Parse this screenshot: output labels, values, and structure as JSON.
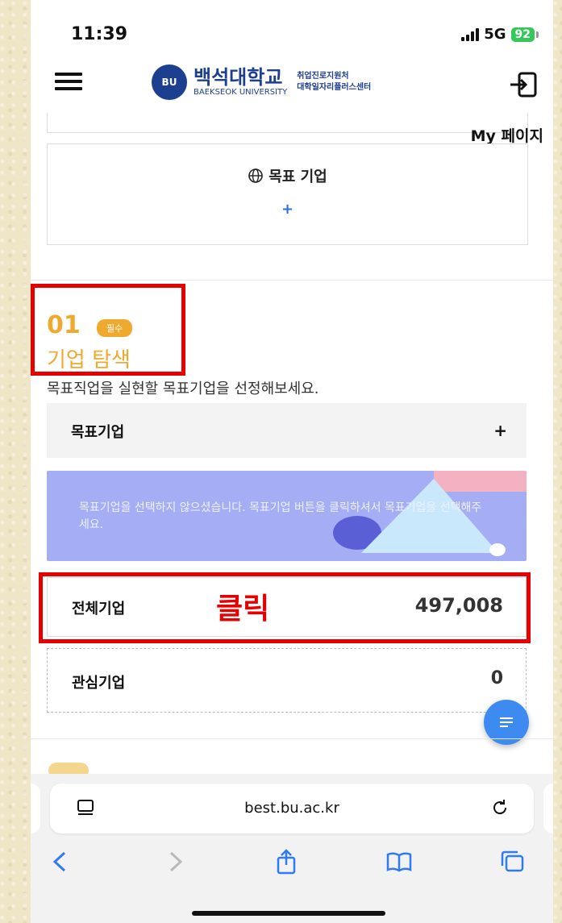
{
  "status_bar": {
    "time": "11:39",
    "network": "5G",
    "battery": "92"
  },
  "header": {
    "logo_emblem": "BU",
    "univ_ko": "백석대학교",
    "univ_en": "BAEKSEOK UNIVERSITY",
    "dept_line1": "취업진로지원처",
    "dept_line2": "대학일자리플러스센터",
    "menu_icon": "hamburger-icon",
    "login_icon": "login-icon"
  },
  "mypage_label": "My 페이지",
  "goal_card": {
    "title": "목표 기업",
    "globe_icon": "globe-icon",
    "plus": "+"
  },
  "step": {
    "number": "01",
    "badge": "필수",
    "title": "기업 탐색",
    "description": "목표직업을 실현할 목표기업을 선정해보세요."
  },
  "target_company": {
    "label": "목표기업",
    "plus": "+"
  },
  "banner": {
    "message": "목표기업을 선택하지 않으셨습니다. 목표기업 버튼을 클릭하셔서 목표기업을 선택해주세요."
  },
  "all_companies": {
    "label": "전체기업",
    "count": "497,008"
  },
  "annotation": {
    "click": "클릭"
  },
  "interest_companies": {
    "label": "관심기업",
    "count": "0"
  },
  "browser": {
    "url": "best.bu.ac.kr"
  },
  "colors": {
    "accent": "#f0a92f",
    "highlight": "#e60000",
    "brand": "#1d3f8f",
    "fab": "#3d8bf0"
  }
}
